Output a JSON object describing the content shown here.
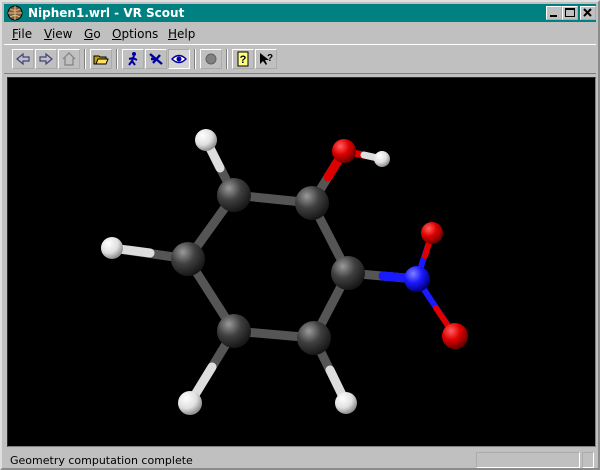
{
  "window": {
    "title": "Niphen1.wrl - VR Scout"
  },
  "menu": [
    {
      "label": "File",
      "mnemonic": "F",
      "rest": "ile"
    },
    {
      "label": "View",
      "mnemonic": "V",
      "rest": "iew"
    },
    {
      "label": "Go",
      "mnemonic": "G",
      "rest": "o"
    },
    {
      "label": "Options",
      "mnemonic": "O",
      "rest": "ptions"
    },
    {
      "label": "Help",
      "mnemonic": "H",
      "rest": "elp"
    }
  ],
  "toolbar": {
    "icons": [
      "back-arrow-icon",
      "forward-arrow-icon",
      "home-icon",
      "open-folder-icon",
      "walk-icon",
      "fly-icon",
      "examine-eye-icon",
      "stop-icon",
      "help-icon",
      "context-help-icon"
    ],
    "pressed": "examine-eye-icon"
  },
  "status": {
    "message": "Geometry computation complete"
  },
  "colors": {
    "titlebar": "#008080",
    "carbon": "#3a3a3a",
    "hydrogen": "#f0f0f0",
    "oxygen": "#e00000",
    "nitrogen": "#1a1aff"
  }
}
